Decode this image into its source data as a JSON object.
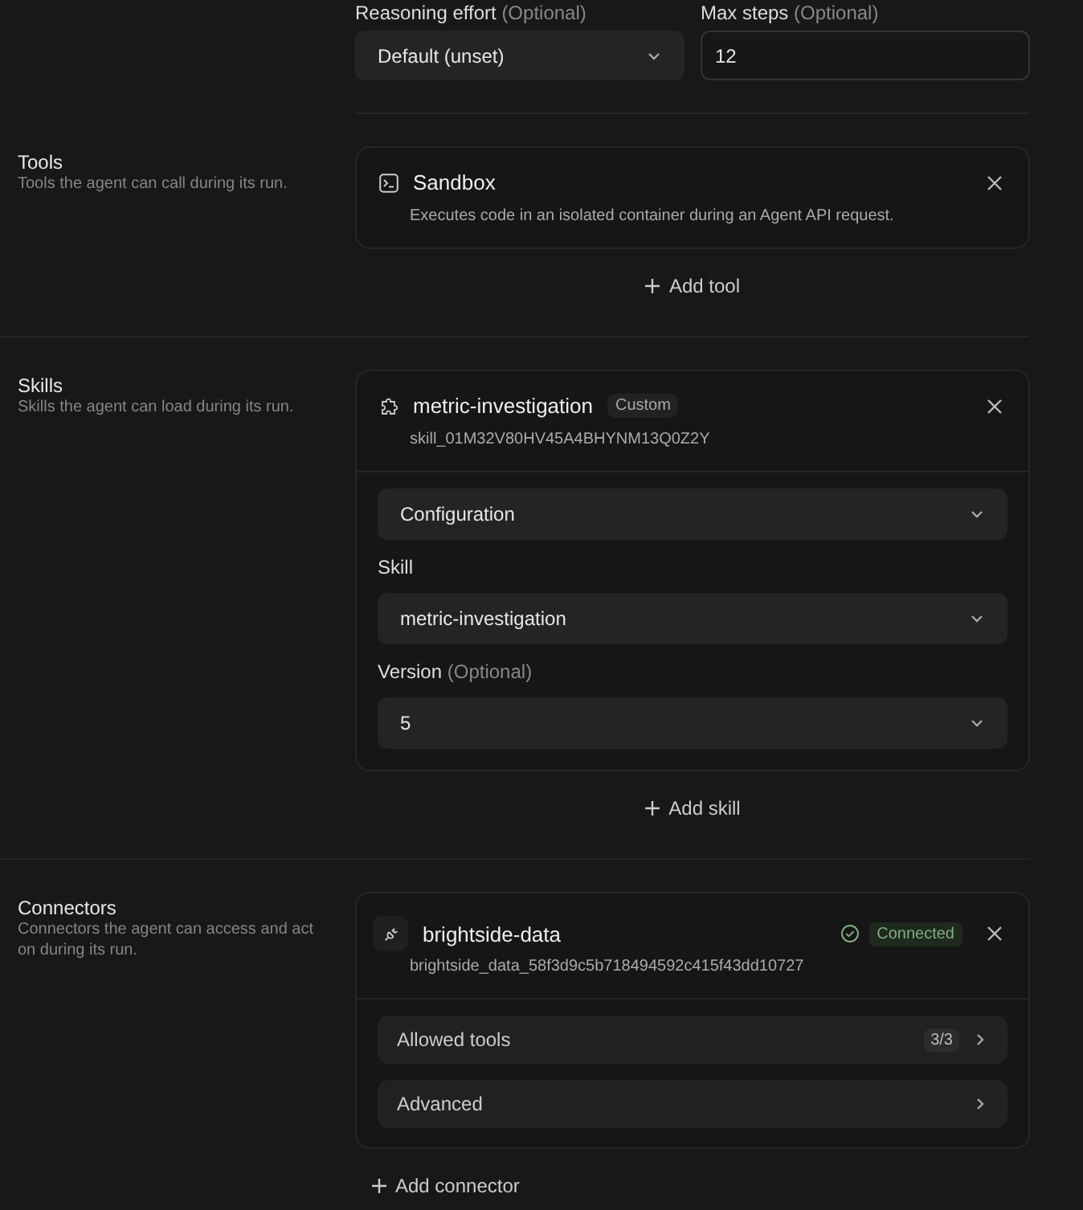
{
  "top_fields": [
    {
      "kind": "select",
      "label": "Reasoning effort",
      "hint": "(Optional)",
      "value": "Default (unset)"
    },
    {
      "kind": "input",
      "label": "Max steps",
      "hint": "(Optional)",
      "value": "12"
    }
  ],
  "sections": [
    {
      "kind": "tools",
      "title": "Tools",
      "description": "Tools the agent can call during its run.",
      "items": [
        {
          "name": "Sandbox",
          "description": "Executes code in an isolated container during an Agent API request."
        }
      ],
      "add_label": "Add tool"
    },
    {
      "kind": "skills",
      "title": "Skills",
      "description": "Skills the agent can load during its run.",
      "items": [
        {
          "name": "metric-investigation",
          "badge": "Custom",
          "id": "skill_01M32V80HV45A4BHYNM13Q0Z2Y",
          "config": {
            "title": "Configuration",
            "expanded": true,
            "fields": [
              {
                "label": "Skill",
                "value": "metric-investigation"
              },
              {
                "label": "Version",
                "hint": "(Optional)",
                "value": "5"
              }
            ]
          }
        }
      ],
      "add_label": "Add skill"
    },
    {
      "kind": "connectors",
      "title": "Connectors",
      "description": "Connectors the agent can access and act on during its run.",
      "items": [
        {
          "name": "brightside-data",
          "status": "Connected",
          "connected": true,
          "id": "brightside_data_58f3d9c5b718494592c415f43dd10727",
          "rows": [
            {
              "label": "Allowed tools",
              "count": "3/3"
            },
            {
              "label": "Advanced"
            }
          ]
        }
      ],
      "add_label": "Add connector"
    }
  ]
}
